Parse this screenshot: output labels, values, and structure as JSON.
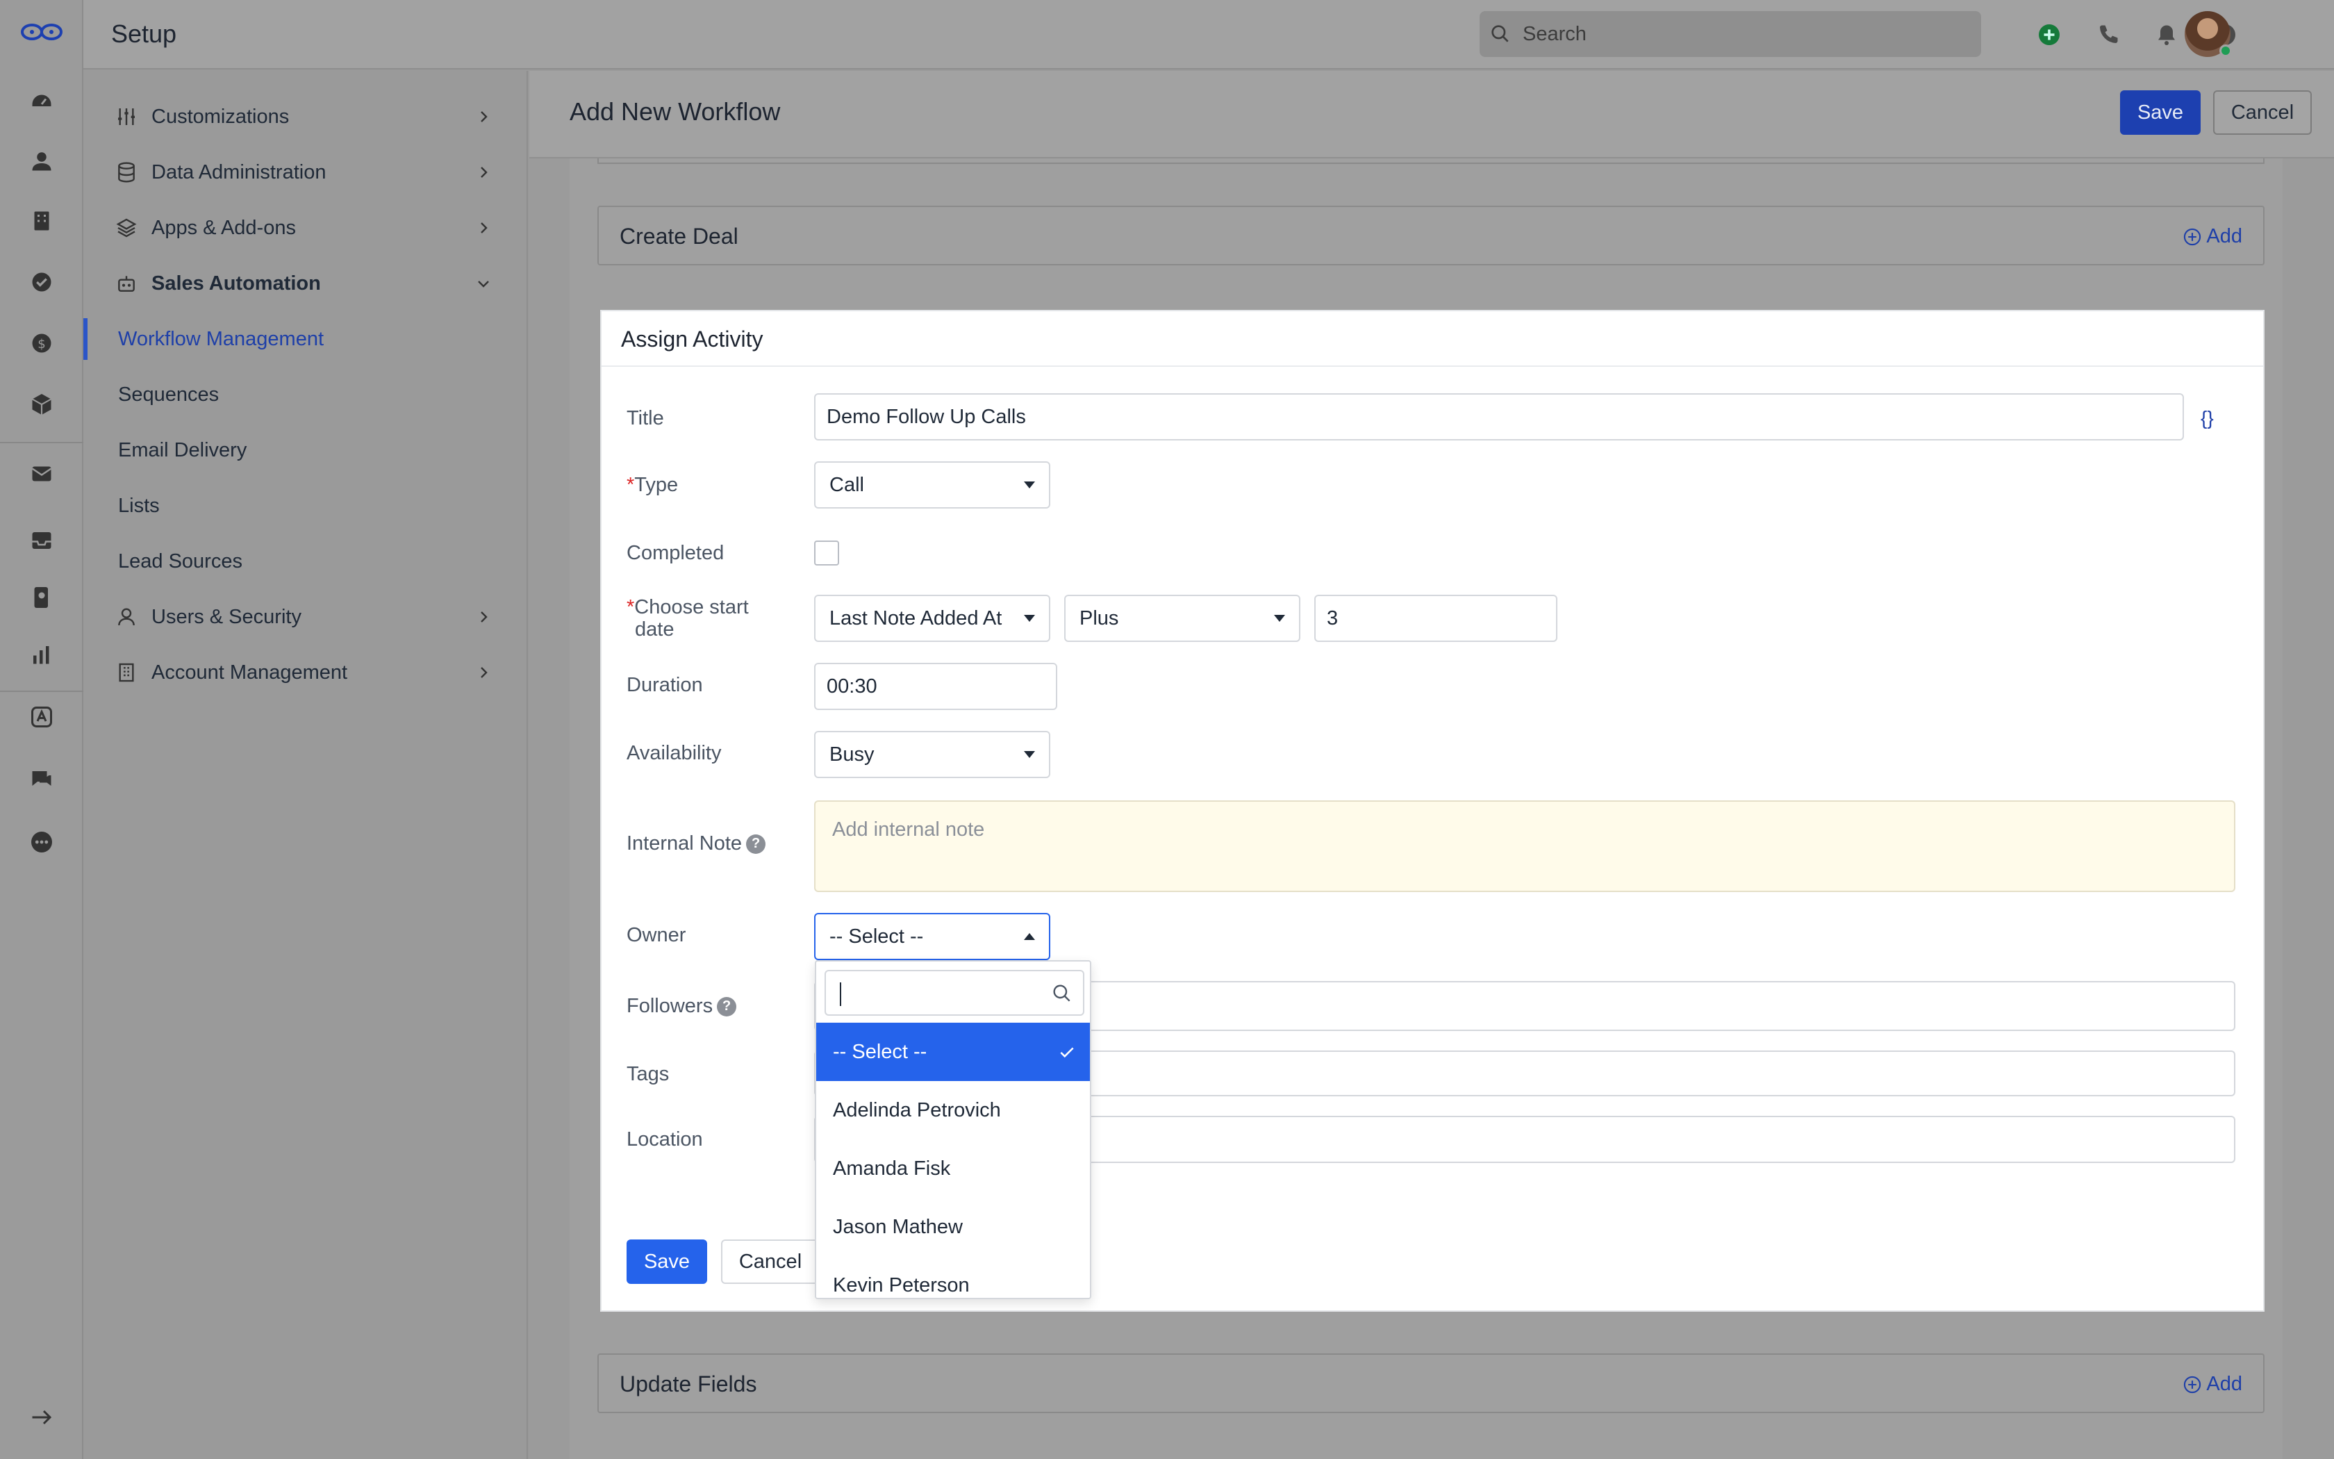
{
  "app": {
    "title": "Setup",
    "search_placeholder": "Search",
    "colors": {
      "accent": "#2563eb",
      "primary_button": "#1d40b0",
      "note_bg": "#fffbea"
    }
  },
  "rail": {
    "icons": [
      "logo-icon",
      "dashboard-icon",
      "contacts-icon",
      "accounts-icon",
      "tasks-icon",
      "deals-icon",
      "products-icon",
      "email-icon",
      "inbox-icon",
      "phone-book-icon",
      "reports-icon",
      "apps-icon",
      "chat-icon",
      "more-icon",
      "expand-icon"
    ]
  },
  "top_icons": [
    "add-icon",
    "phone-icon",
    "bell-icon",
    "help-icon"
  ],
  "nav": {
    "items": [
      {
        "label": "Customizations"
      },
      {
        "label": "Data Administration"
      },
      {
        "label": "Apps & Add-ons"
      },
      {
        "label": "Sales Automation"
      }
    ],
    "sub_items": [
      {
        "label": "Workflow Management"
      },
      {
        "label": "Sequences"
      },
      {
        "label": "Email Delivery"
      },
      {
        "label": "Lists"
      },
      {
        "label": "Lead Sources"
      }
    ],
    "bottom_items": [
      {
        "label": "Users & Security"
      },
      {
        "label": "Account Management"
      }
    ]
  },
  "header": {
    "title": "Add New Workflow",
    "save_label": "Save",
    "cancel_label": "Cancel"
  },
  "sections": {
    "create_deal": {
      "title": "Create Deal",
      "add_label": "Add"
    },
    "update_fields": {
      "title": "Update Fields",
      "add_label": "Add"
    }
  },
  "assign_activity": {
    "title": "Assign Activity",
    "fields": {
      "title_label": "Title",
      "title_value": "Demo Follow Up Calls",
      "title_token": "{}",
      "type_req": "*",
      "type_label": "Type",
      "type_value": "Call",
      "completed_label": "Completed",
      "start_req": "*",
      "start_label_1": "Choose start",
      "start_label_2": "date",
      "start_field": "Last Note Added At",
      "start_op": "Plus",
      "start_amount": "3",
      "duration_label": "Duration",
      "duration_value": "00:30",
      "availability_label": "Availability",
      "availability_value": "Busy",
      "note_label": "Internal Note",
      "note_placeholder": "Add internal note",
      "owner_label": "Owner",
      "owner_value": "-- Select --",
      "followers_label": "Followers",
      "tags_label": "Tags",
      "location_label": "Location",
      "help_glyph": "?"
    },
    "save_label": "Save",
    "cancel_label": "Cancel"
  },
  "owner_dropdown": {
    "options": [
      {
        "label": "-- Select --"
      },
      {
        "label": "Adelinda Petrovich"
      },
      {
        "label": "Amanda Fisk"
      },
      {
        "label": "Jason Mathew"
      },
      {
        "label": "Kevin Peterson"
      }
    ]
  }
}
